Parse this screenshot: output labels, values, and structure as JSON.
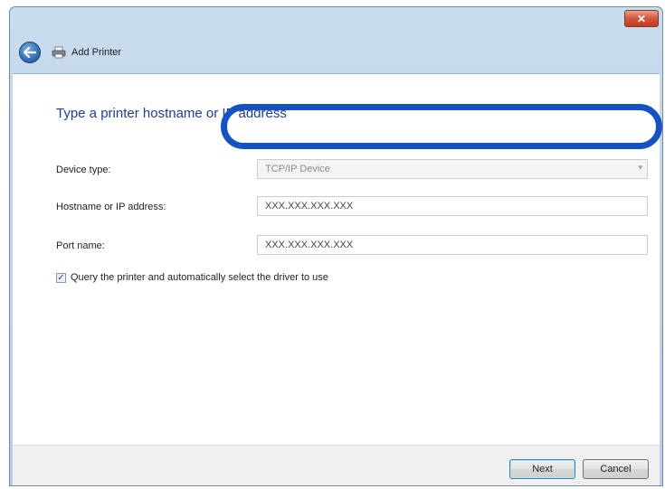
{
  "window": {
    "title": "Add Printer",
    "close_symbol": "✕"
  },
  "icons": {
    "back": "back-arrow-icon",
    "printer": "printer-icon",
    "close": "close-icon"
  },
  "main": {
    "heading": "Type a printer hostname or IP address",
    "device_type": {
      "label": "Device type:",
      "value": "TCP/IP Device"
    },
    "hostname": {
      "label": "Hostname or IP address:",
      "value": "XXX.XXX.XXX.XXX"
    },
    "port_name": {
      "label": "Port name:",
      "value": "XXX.XXX.XXX.XXX"
    },
    "query_checkbox": {
      "label": "Query the printer and automatically select the driver to use",
      "checked": true,
      "mark": "✓"
    }
  },
  "footer": {
    "next_label": "Next",
    "cancel_label": "Cancel"
  },
  "colors": {
    "highlight": "#1553c4",
    "heading": "#1e3f8a"
  }
}
